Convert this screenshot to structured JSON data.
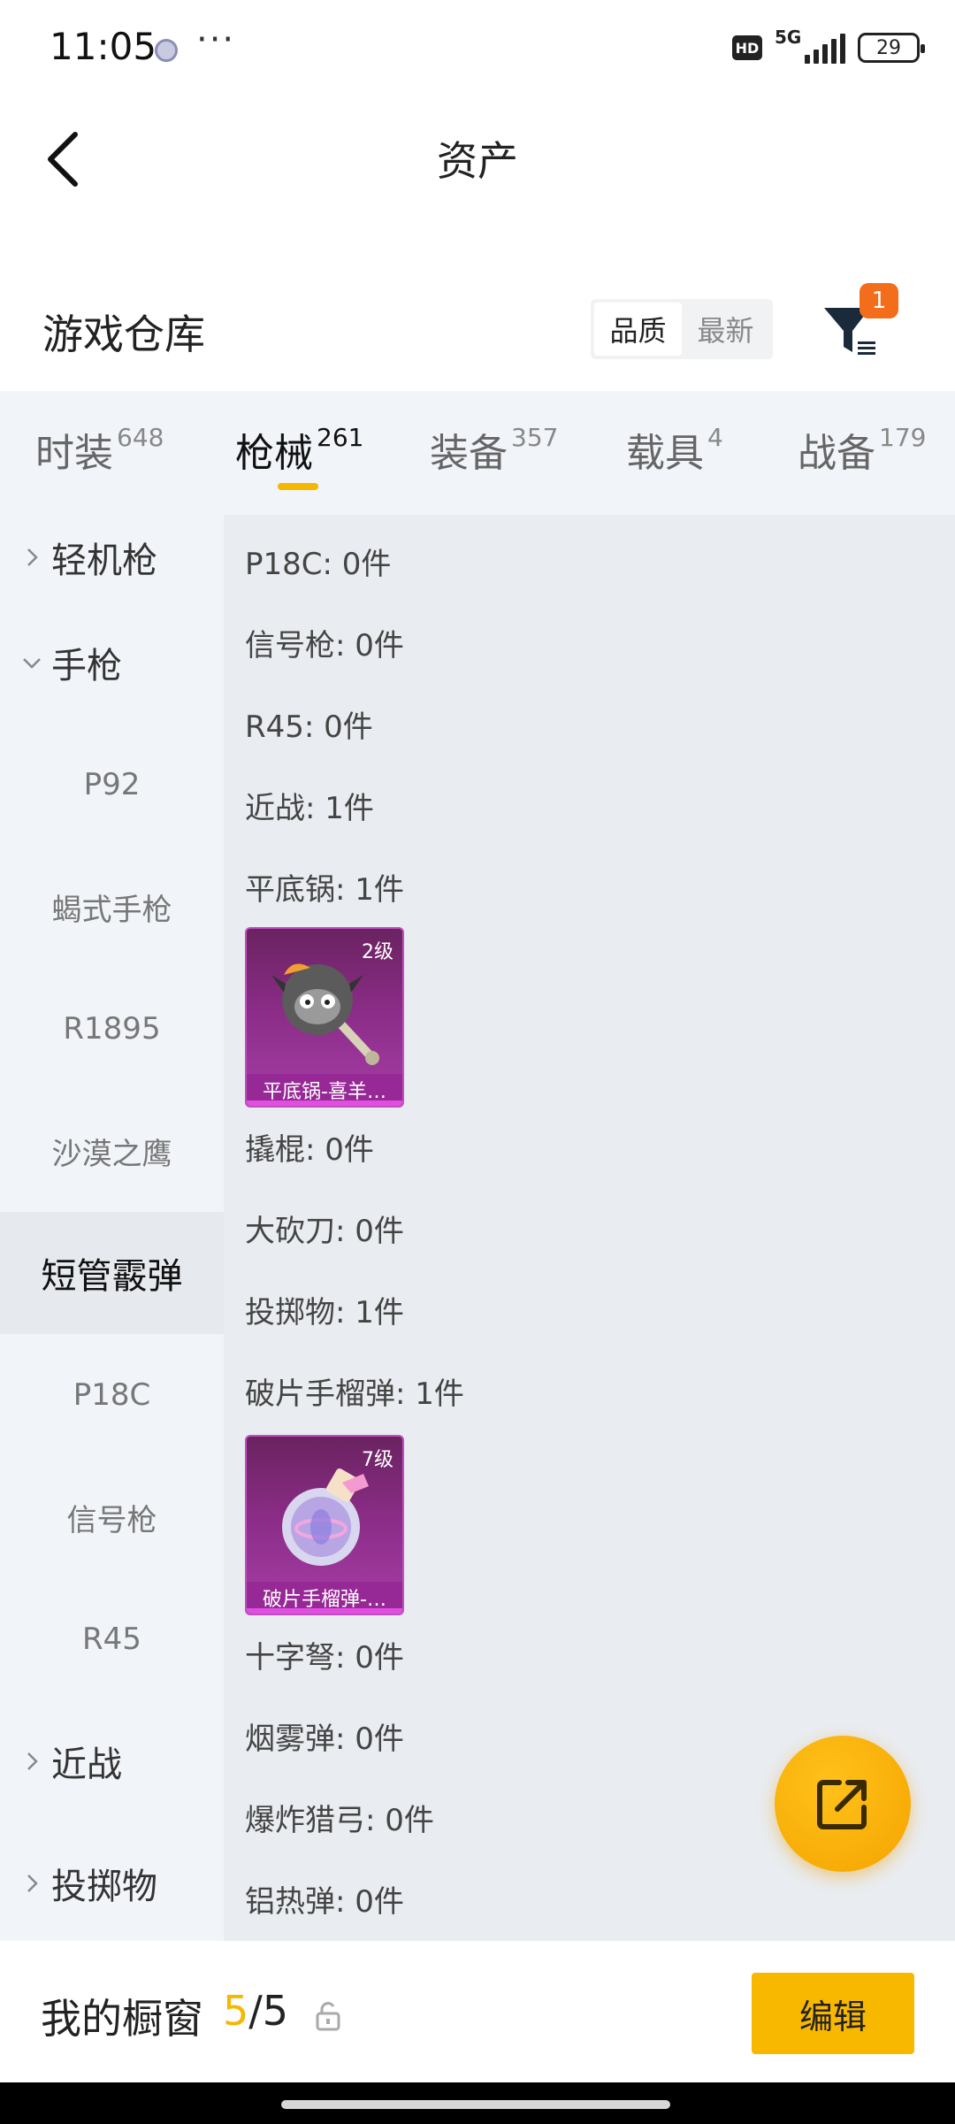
{
  "status_bar": {
    "time": "11:05",
    "more": "···",
    "network": "5G",
    "hd": "HD",
    "battery": "29"
  },
  "header": {
    "title": "资产"
  },
  "warehouse": {
    "title": "游戏仓库",
    "sort_options": [
      "品质",
      "最新"
    ],
    "sort_selected": "品质",
    "filter_badge": "1"
  },
  "tabs": [
    {
      "label": "时装",
      "count": "648"
    },
    {
      "label": "枪械",
      "count": "261",
      "active": true
    },
    {
      "label": "装备",
      "count": "357"
    },
    {
      "label": "载具",
      "count": "4"
    },
    {
      "label": "战备",
      "count": "179"
    }
  ],
  "sidebar": [
    {
      "label": "轻机枪",
      "type": "group",
      "expanded": false
    },
    {
      "label": "手枪",
      "type": "group",
      "expanded": true
    },
    {
      "label": "P92",
      "type": "sub"
    },
    {
      "label": "蝎式手枪",
      "type": "sub"
    },
    {
      "label": "R1895",
      "type": "sub"
    },
    {
      "label": "沙漠之鹰",
      "type": "sub"
    },
    {
      "label": "短管霰弹",
      "type": "sub",
      "active": true
    },
    {
      "label": "P18C",
      "type": "sub"
    },
    {
      "label": "信号枪",
      "type": "sub"
    },
    {
      "label": "R45",
      "type": "sub"
    },
    {
      "label": "近战",
      "type": "group",
      "expanded": false
    },
    {
      "label": "投掷物",
      "type": "group",
      "expanded": false
    }
  ],
  "content": {
    "lines": [
      "P18C: 0件",
      "信号枪: 0件",
      "R45: 0件",
      "近战: 1件",
      "平底锅: 1件",
      "撬棍: 0件",
      "大砍刀: 0件",
      "投掷物: 1件",
      "破片手榴弹: 1件",
      "十字弩: 0件",
      "烟雾弹: 0件",
      "爆炸猎弓: 0件",
      "铝热弹: 0件"
    ],
    "items": [
      {
        "level": "2级",
        "name": "平底锅-喜羊…",
        "icon": "pan-icon"
      },
      {
        "level": "7级",
        "name": "破片手榴弹-…",
        "icon": "grenade-icon"
      }
    ]
  },
  "bottom_bar": {
    "label": "我的橱窗",
    "current": "5",
    "separator": "/",
    "total": "5",
    "edit_label": "编辑"
  },
  "colors": {
    "accent": "#f5b700",
    "badge": "#f46d1b",
    "card_purple": "#8a2c86"
  }
}
